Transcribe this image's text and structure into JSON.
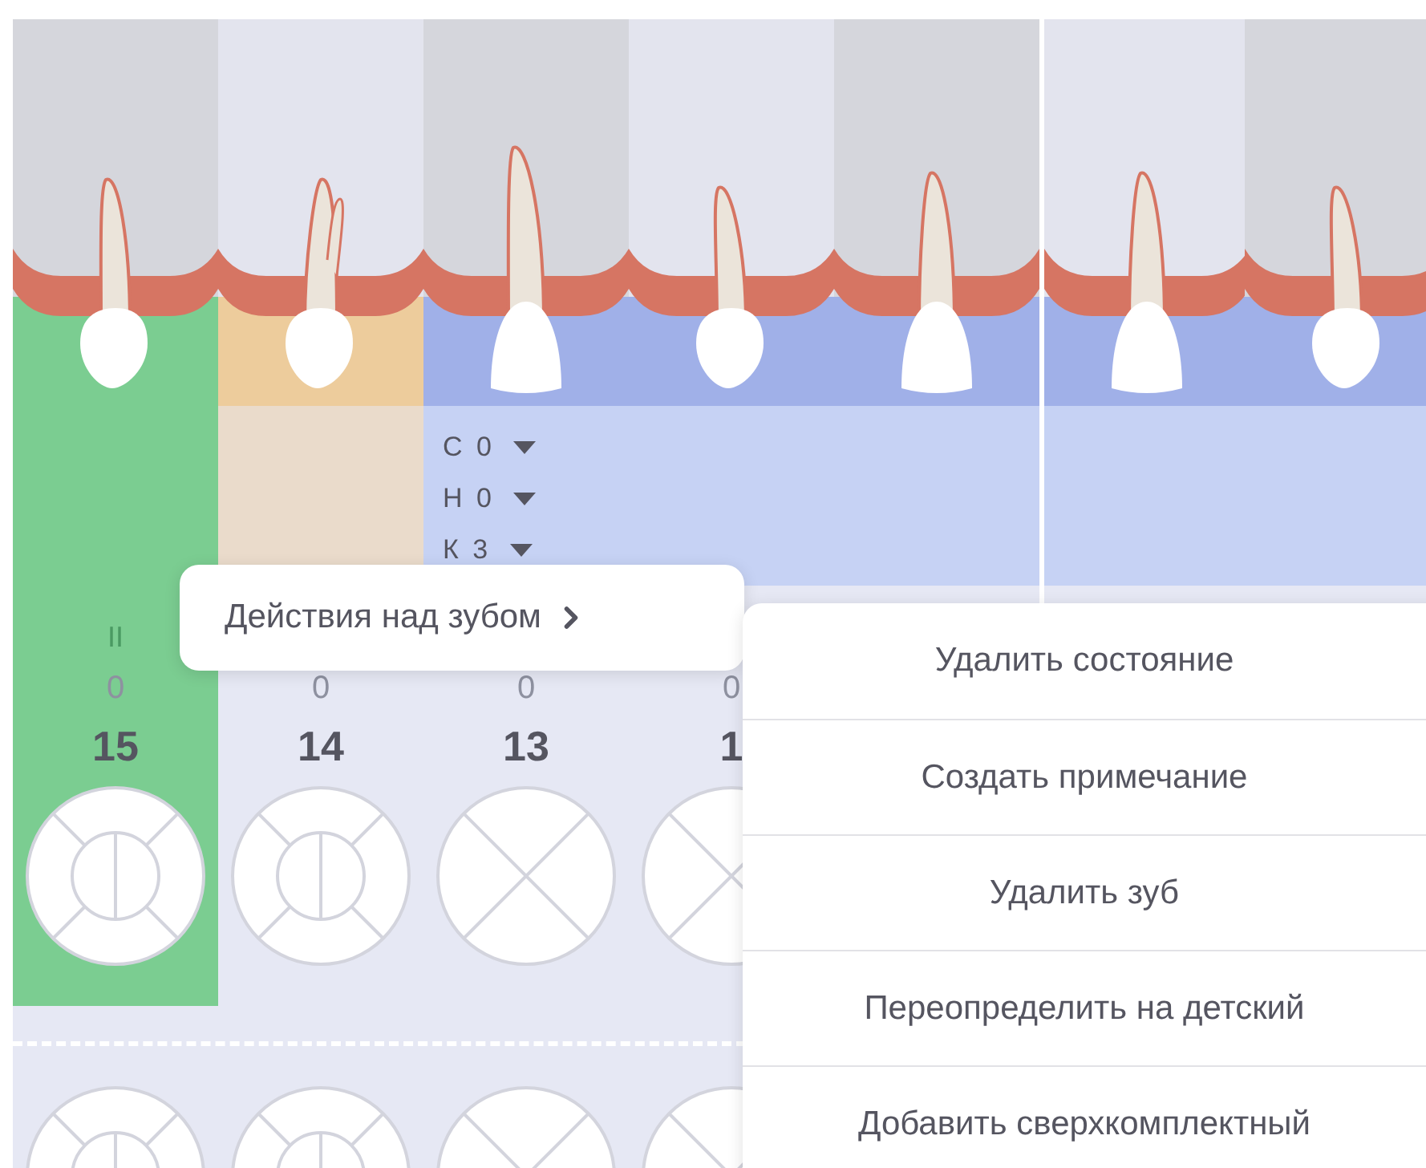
{
  "upper_teeth": [
    {
      "kind": "premolar",
      "selected": true,
      "color": "#7bcd91",
      "mark": "II",
      "zero": "0",
      "number": "15",
      "surface": {
        "kind": "premolar"
      }
    },
    {
      "kind": "premolar2",
      "selected": false,
      "color": "#edcc9c",
      "zero": "0",
      "number": "14",
      "surface": {
        "kind": "premolar"
      }
    },
    {
      "kind": "canine",
      "selected": false,
      "color": "#a0b0e8",
      "zero": "0",
      "number": "13",
      "surface": {
        "kind": "incisor"
      },
      "selects": [
        {
          "label": "С 0"
        },
        {
          "label": "Н 0"
        },
        {
          "label": "К 3"
        }
      ]
    },
    {
      "kind": "incisor",
      "selected": false,
      "color": "#a0b0e8",
      "zero": "0",
      "number": "1",
      "surface": {
        "kind": "incisor"
      }
    },
    {
      "kind": "central",
      "selected": false,
      "color": "#a0b0e8"
    },
    {
      "kind": "central",
      "selected": false,
      "color": "#a0b0e8"
    },
    {
      "kind": "incisor",
      "selected": false,
      "color": "#a0b0e8"
    }
  ],
  "lower_teeth": [
    {
      "kind": "premolar"
    },
    {
      "kind": "premolar"
    },
    {
      "kind": "incisor"
    },
    {
      "kind": "incisor"
    }
  ],
  "tooth_actions": {
    "label": "Действия над зубом"
  },
  "context_menu": [
    "Удалить состояние",
    "Создать примечание",
    "Удалить зуб",
    "Переопределить на детский",
    "Добавить сверхкомплектный"
  ]
}
